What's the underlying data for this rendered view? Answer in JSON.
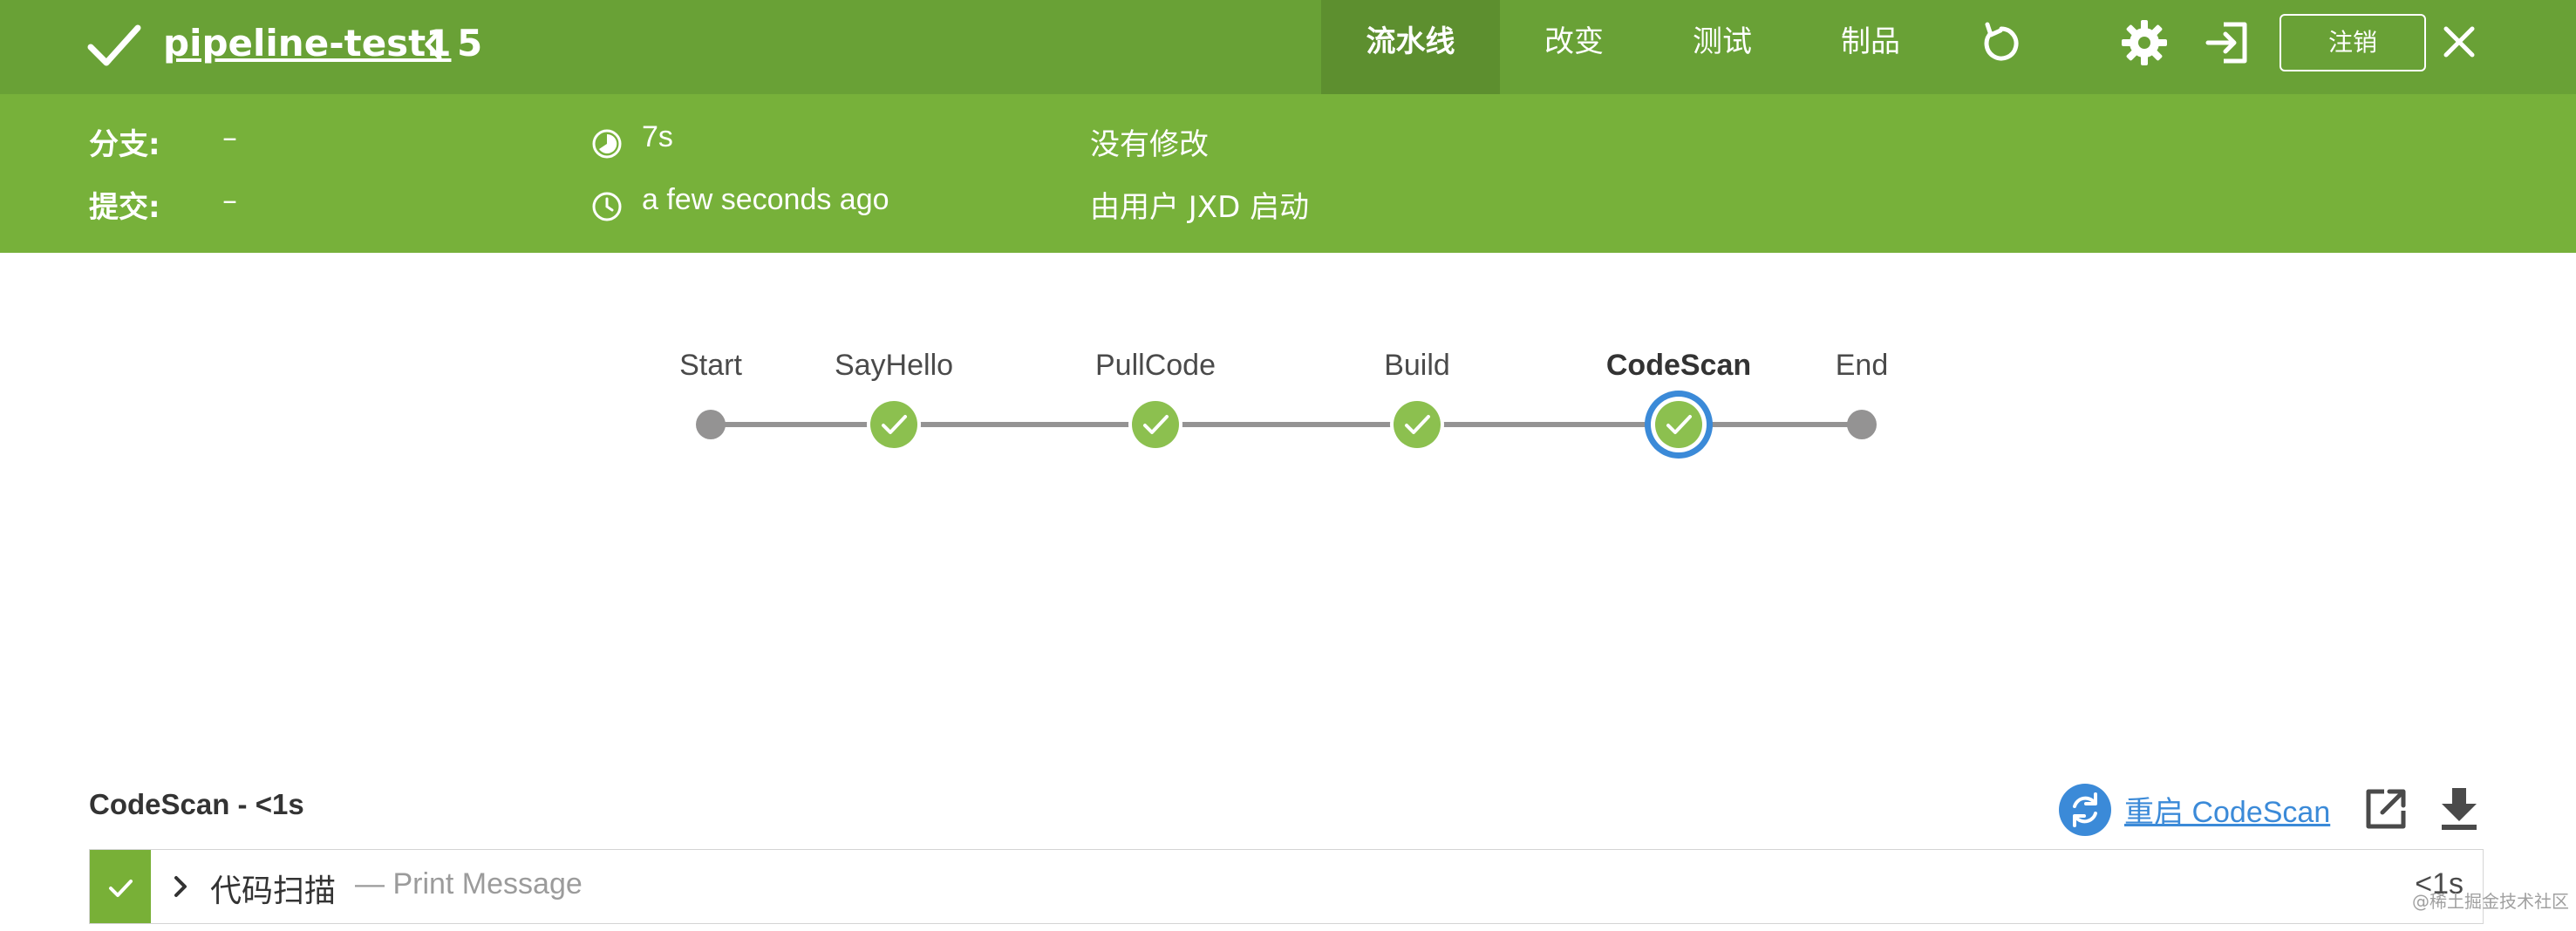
{
  "header": {
    "pipeline_name": "pipeline-test1",
    "run_number": "5",
    "tabs": [
      {
        "label": "流水线",
        "active": true
      },
      {
        "label": "改变",
        "active": false
      },
      {
        "label": "测试",
        "active": false
      },
      {
        "label": "制品",
        "active": false
      }
    ],
    "logout_label": "注销",
    "icons": [
      "check-icon",
      "chevron-left-icon",
      "replay-icon",
      "gear-icon",
      "exit-icon",
      "close-icon"
    ]
  },
  "info": {
    "branch_label": "分支:",
    "branch_value": "–",
    "commit_label": "提交:",
    "commit_value": "–",
    "duration": "7s",
    "started": "a few seconds ago",
    "changes": "没有修改",
    "trigger": "由用户 JXD 启动"
  },
  "pipeline": {
    "stages": [
      {
        "name": "Start",
        "status": "node"
      },
      {
        "name": "SayHello",
        "status": "success"
      },
      {
        "name": "PullCode",
        "status": "success"
      },
      {
        "name": "Build",
        "status": "success"
      },
      {
        "name": "CodeScan",
        "status": "success",
        "selected": true
      },
      {
        "name": "End",
        "status": "node"
      }
    ]
  },
  "step_panel": {
    "title": "CodeScan - <1s",
    "restart_label": "重启 CodeScan",
    "steps": [
      {
        "name": "代码扫描",
        "description": "— Print Message",
        "duration": "<1s",
        "status": "success"
      }
    ]
  },
  "watermark": "@稀土掘金技术社区",
  "colors": {
    "header_bg": "#69a136",
    "infobar_bg": "#77b13a",
    "success": "#8cc04f",
    "selected_ring": "#3b8ad8",
    "link": "#3b8ad8",
    "connector": "#949393"
  }
}
